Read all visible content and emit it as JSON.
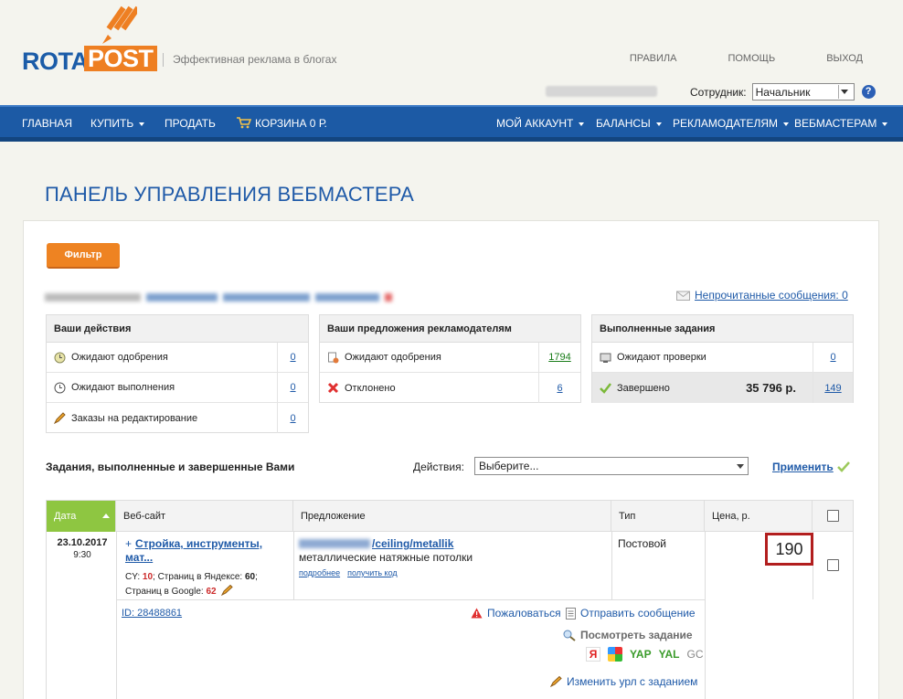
{
  "brand": {
    "logo_left": "ROTA",
    "logo_right": "POST",
    "tagline": "Эффективная реклама в блогах"
  },
  "top_links": [
    "ПРАВИЛА",
    "ПОМОЩЬ",
    "ВЫХОД"
  ],
  "employee": {
    "label": "Сотрудник:",
    "selected": "Начальник"
  },
  "nav": {
    "home": "ГЛАВНАЯ",
    "buy": "КУПИТЬ",
    "sell": "ПРОДАТЬ",
    "cart": "КОРЗИНА 0 Р.",
    "account": "МОЙ АККАУНТ",
    "balances": "БАЛАНСЫ",
    "advertisers": "РЕКЛАМОДАТЕЛЯМ",
    "webmasters": "ВЕБМАСТЕРАМ"
  },
  "page_title": "ПАНЕЛЬ УПРАВЛЕНИЯ ВЕБМАСТЕРА",
  "filter_button": "Фильтр",
  "unread_messages": "Непрочитанные сообщения: 0",
  "boxes": {
    "your_actions": {
      "title": "Ваши действия",
      "rows": [
        {
          "label": "Ожидают одобрения",
          "count": "0"
        },
        {
          "label": "Ожидают выполнения",
          "count": "0"
        },
        {
          "label": "Заказы на редактирование",
          "count": "0"
        }
      ]
    },
    "offers": {
      "title": "Ваши предложения рекламодателям",
      "rows": [
        {
          "label": "Ожидают одобрения",
          "count": "1794"
        },
        {
          "label": "Отклонено",
          "count": "6"
        }
      ]
    },
    "completed": {
      "title": "Выполненные задания",
      "rows": [
        {
          "label": "Ожидают проверки",
          "count": "0"
        },
        {
          "label": "Завершено",
          "amount": "35 796 р.",
          "count": "149"
        }
      ]
    }
  },
  "tasks_section": {
    "title": "Задания, выполненные и завершенные Вами",
    "actions_label": "Действия:",
    "actions_selected": "Выберите...",
    "apply": "Применить"
  },
  "table": {
    "headers": {
      "date": "Дата",
      "site": "Веб-сайт",
      "offer": "Предложение",
      "type": "Тип",
      "price": "Цена, р."
    },
    "row": {
      "date": "23.10.2017",
      "time": "9:30",
      "site_title": "Стройка, инструменты, мат...",
      "cy_label": "CY:",
      "cy": "10",
      "yandex_label": "; Страниц в Яндексе:",
      "yandex_pages": "60",
      "google_label": "Страниц в Google:",
      "google_pages": "62",
      "offer_url": "/ceiling/metallik",
      "offer_desc": "металлические натяжные потолки",
      "more": "подробнее",
      "get_code": "получить код",
      "type": "Постовой",
      "price": "190",
      "id": "ID: 28488861",
      "complain": "Пожаловаться",
      "send_message": "Отправить сообщение",
      "view_task": "Посмотреть задание",
      "engine_ya": "Я",
      "engine_yap": "YAP",
      "engine_yal": "YAL",
      "engine_gc": "GC",
      "change_url": "Изменить урл с заданием"
    }
  },
  "colors": {
    "brand_blue": "#1c5aa5",
    "brand_orange": "#ee7f22",
    "accent_green": "#8ec641",
    "price_border": "#b21e1e"
  }
}
